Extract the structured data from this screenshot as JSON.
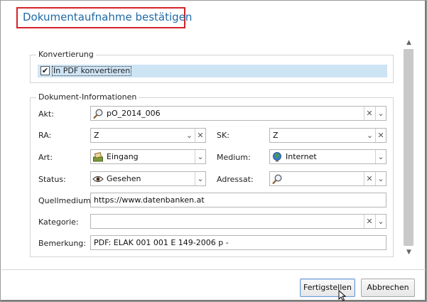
{
  "dialog": {
    "title": "Dokumentaufnahme bestätigen"
  },
  "konvertierung": {
    "legend": "Konvertierung",
    "checkbox_label": "In PDF konvertieren",
    "checked": true
  },
  "info": {
    "legend": "Dokument-Informationen",
    "akt": {
      "label": "Akt:",
      "value": "pO_2014_006",
      "icon": "search-icon"
    },
    "ra": {
      "label": "RA:",
      "value": "Z"
    },
    "sk": {
      "label": "SK:",
      "value": "Z"
    },
    "art": {
      "label": "Art:",
      "value": "Eingang",
      "icon": "inbox-tray-icon"
    },
    "medium": {
      "label": "Medium:",
      "value": "Internet",
      "icon": "globe-icon"
    },
    "status": {
      "label": "Status:",
      "value": "Gesehen",
      "icon": "eye-icon"
    },
    "adressat": {
      "label": "Adressat:",
      "value": "",
      "icon": "search-icon"
    },
    "quellmedium": {
      "label": "Quellmedium:",
      "value": "https://www.datenbanken.at"
    },
    "kategorie": {
      "label": "Kategorie:",
      "value": ""
    },
    "bemerkung": {
      "label": "Bemerkung:",
      "value": "PDF: ELAK 001 001 E 149-2006 p -"
    }
  },
  "buttons": {
    "finish": "Fertigstellen",
    "cancel": "Abbrechen"
  },
  "glyphs": {
    "clear": "✕",
    "dropdown": "⌄",
    "check": "✔",
    "scroll_up": "▲",
    "scroll_down": "▼"
  },
  "colors": {
    "title": "#1f6aa5",
    "title_highlight_border": "#d4232b",
    "selection_row": "#cde4f5"
  }
}
